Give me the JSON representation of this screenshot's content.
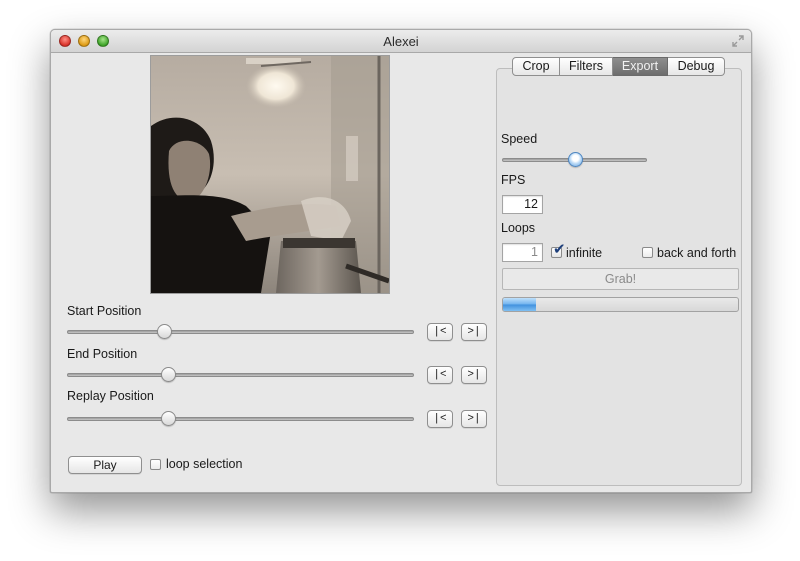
{
  "window": {
    "title": "Alexei"
  },
  "left": {
    "start_label": "Start Position",
    "end_label": "End Position",
    "replay_label": "Replay Position",
    "to_start_label": "|<",
    "to_end_label": ">|",
    "play_label": "Play",
    "loop_selection_label": "loop selection",
    "loop_selection_checked": false,
    "start_position": 0.28,
    "end_position": 0.29,
    "replay_position": 0.29
  },
  "tabs": [
    {
      "label": "Crop",
      "active": false
    },
    {
      "label": "Filters",
      "active": false
    },
    {
      "label": "Export",
      "active": true
    },
    {
      "label": "Debug",
      "active": false
    }
  ],
  "export": {
    "speed_label": "Speed",
    "speed_value": 0.5,
    "fps_label": "FPS",
    "fps_value": "12",
    "loops_label": "Loops",
    "loops_value": "1",
    "infinite_label": "infinite",
    "infinite_checked": true,
    "back_and_forth_label": "back and forth",
    "back_and_forth_checked": false,
    "grab_label": "Grab!",
    "progress": 0.14
  },
  "colors": {
    "accent": "#4f96e2",
    "active_tab": "#7a7a7a"
  },
  "icons": {
    "fullscreen": "fullscreen-icon",
    "check": "checkmark-icon"
  }
}
